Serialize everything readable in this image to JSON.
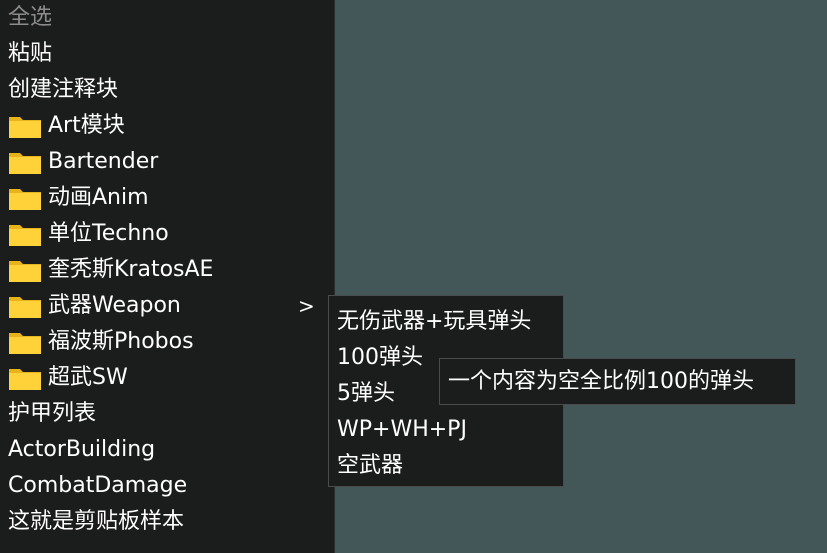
{
  "menu": {
    "items": [
      {
        "label": "全选",
        "disabled": true
      },
      {
        "label": "粘贴"
      },
      {
        "label": "创建注释块"
      },
      {
        "label": "Art模块",
        "icon": "folder-icon"
      },
      {
        "label": "Bartender",
        "icon": "folder-icon"
      },
      {
        "label": "动画Anim",
        "icon": "folder-icon"
      },
      {
        "label": "单位Techno",
        "icon": "folder-icon"
      },
      {
        "label": "奎秃斯KratosAE",
        "icon": "folder-icon"
      },
      {
        "label": "武器Weapon",
        "icon": "folder-icon",
        "submenu_arrow": ">"
      },
      {
        "label": "福波斯Phobos",
        "icon": "folder-icon"
      },
      {
        "label": "超武SW",
        "icon": "folder-icon"
      },
      {
        "label": "护甲列表"
      },
      {
        "label": "ActorBuilding"
      },
      {
        "label": "CombatDamage"
      },
      {
        "label": "这就是剪贴板样本"
      }
    ]
  },
  "submenu": {
    "items": [
      {
        "label": "无伤武器+玩具弹头"
      },
      {
        "label": "100弹头"
      },
      {
        "label": "5弹头"
      },
      {
        "label": "WP+WH+PJ"
      },
      {
        "label": "空武器"
      }
    ]
  },
  "tooltip": {
    "text": "一个内容为空全比例100的弹头"
  },
  "colors": {
    "desktop_bg": "#435758",
    "menu_bg": "#1b1c1c",
    "text": "#ffffff",
    "disabled_text": "#8c8c8c",
    "folder_yellow": "#ffd23a"
  }
}
